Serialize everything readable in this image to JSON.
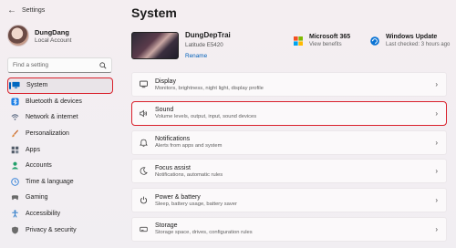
{
  "window": {
    "title": "Settings"
  },
  "profile": {
    "name": "DungDang",
    "account": "Local Account"
  },
  "search": {
    "placeholder": "Find a setting"
  },
  "nav": [
    {
      "label": "System",
      "icon": "monitor-icon",
      "color": "#0067c0"
    },
    {
      "label": "Bluetooth & devices",
      "icon": "bluetooth-icon",
      "color": "#1b7ee6"
    },
    {
      "label": "Network & internet",
      "icon": "network-icon",
      "color": "#5b6a82"
    },
    {
      "label": "Personalization",
      "icon": "brush-icon",
      "color": "#c7682b"
    },
    {
      "label": "Apps",
      "icon": "apps-icon",
      "color": "#555e6b"
    },
    {
      "label": "Accounts",
      "icon": "person-icon",
      "color": "#22a06b"
    },
    {
      "label": "Time & language",
      "icon": "globe-clock-icon",
      "color": "#2b7dd8"
    },
    {
      "label": "Gaming",
      "icon": "gamepad-icon",
      "color": "#6b6b6b"
    },
    {
      "label": "Accessibility",
      "icon": "accessibility-icon",
      "color": "#2878c8"
    },
    {
      "label": "Privacy & security",
      "icon": "shield-icon",
      "color": "#6c6c6c"
    }
  ],
  "page": {
    "title": "System"
  },
  "device": {
    "name": "DungDepTrai",
    "model": "Latitude E5420",
    "rename": "Rename"
  },
  "microsoft365": {
    "title": "Microsoft 365",
    "sub": "View benefits"
  },
  "windows_update": {
    "title": "Windows Update",
    "sub": "Last checked: 3 hours ago"
  },
  "cards": [
    {
      "title": "Display",
      "desc": "Monitors, brightness, night light, display profile",
      "icon": "display-icon"
    },
    {
      "title": "Sound",
      "desc": "Volume levels, output, input, sound devices",
      "icon": "speaker-icon"
    },
    {
      "title": "Notifications",
      "desc": "Alerts from apps and system",
      "icon": "bell-icon"
    },
    {
      "title": "Focus assist",
      "desc": "Notifications, automatic rules",
      "icon": "moon-icon"
    },
    {
      "title": "Power & battery",
      "desc": "Sleep, battery usage, battery saver",
      "icon": "power-icon"
    },
    {
      "title": "Storage",
      "desc": "Storage space, drives, configuration rules",
      "icon": "storage-icon"
    }
  ]
}
